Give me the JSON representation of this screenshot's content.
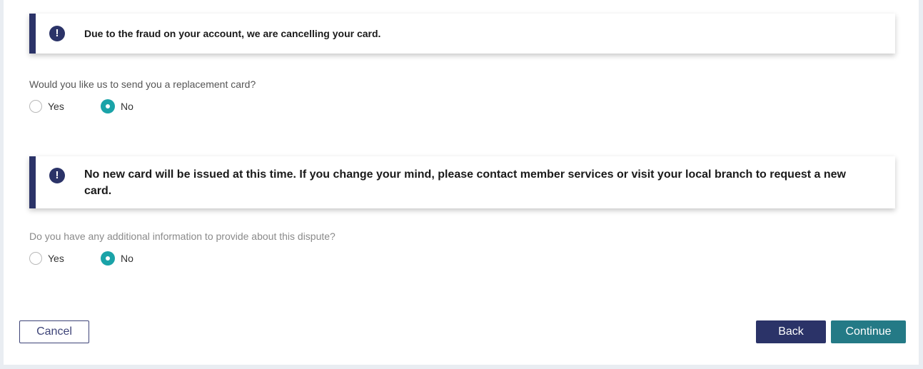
{
  "alerts": [
    {
      "icon": "exclamation-icon",
      "text": "Due to the fraud on your account, we are cancelling your card."
    },
    {
      "icon": "exclamation-icon",
      "text": "No new card will be issued at this time. If you change your mind, please contact member services or visit your local branch to request a new card."
    }
  ],
  "questions": [
    {
      "text": "Would you like us to send you a replacement card?",
      "options": [
        {
          "label": "Yes",
          "checked": false
        },
        {
          "label": "No",
          "checked": true
        }
      ]
    },
    {
      "text": "Do you have any additional information to provide about this dispute?",
      "options": [
        {
          "label": "Yes",
          "checked": false
        },
        {
          "label": "No",
          "checked": true
        }
      ]
    }
  ],
  "buttons": {
    "cancel": "Cancel",
    "back": "Back",
    "continue": "Continue"
  },
  "colors": {
    "accent_navy": "#2b3368",
    "accent_teal": "#1aa3a8",
    "continue_teal": "#247a86"
  }
}
